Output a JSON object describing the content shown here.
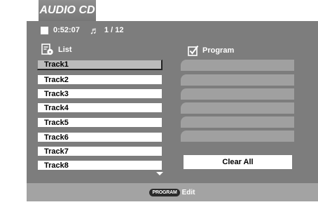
{
  "header": {
    "tab_label": "AUDIO CD"
  },
  "status": {
    "stop_icon": "stop-icon",
    "time": "0:52:07",
    "note_icon": "music-note-icon",
    "track_counter": "1 / 12"
  },
  "list": {
    "title": "List",
    "icon": "list-disc-icon",
    "tracks": [
      "Track1",
      "Track2",
      "Track3",
      "Track4",
      "Track5",
      "Track6",
      "Track7",
      "Track8"
    ],
    "selected_index": 0
  },
  "program": {
    "title": "Program",
    "icon": "checkbox-icon",
    "slots": [
      "",
      "",
      "",
      "",
      "",
      ""
    ],
    "clear_all_label": "Clear All"
  },
  "footer": {
    "badge": "PROGRAM",
    "hint": "Edit"
  },
  "colors": {
    "panel": "#7d7d7d",
    "footer": "#a3a3a3",
    "tab": "#888888",
    "slot": "#a0a0a0",
    "selected": "#bcbcbc"
  }
}
